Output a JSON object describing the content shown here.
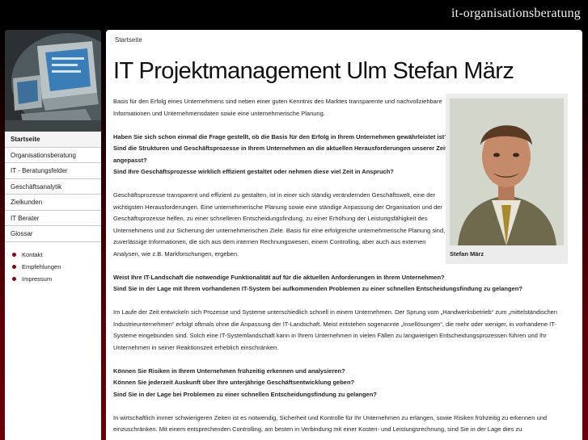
{
  "header": {
    "brand": "it-organisationsberatung"
  },
  "sidebar": {
    "nav": [
      {
        "label": "Startseite",
        "active": true
      },
      {
        "label": "Organisationsberatung",
        "active": false
      },
      {
        "label": "IT - Beratungsfelder",
        "active": false
      },
      {
        "label": "Geschäftsanalytik",
        "active": false
      },
      {
        "label": "Zielkunden",
        "active": false
      },
      {
        "label": "IT Berater",
        "active": false
      },
      {
        "label": "Glossar",
        "active": false
      }
    ],
    "subnav": [
      {
        "label": "Kontakt"
      },
      {
        "label": "Empfehlungen"
      },
      {
        "label": "Impressum"
      }
    ]
  },
  "main": {
    "breadcrumb": "Startseite",
    "title": "IT Projektmanagement Ulm Stefan März",
    "photo_caption": "Stefan März",
    "paragraphs": {
      "p1": "Basis für den Erfolg eines Unternehmens sind neben einer guten Kenntnis des Marktes transparente und nachvollziehbare Informationen und Unternehmensdaten sowie eine unternehmerische Planung.",
      "q1a": "Haben Sie sich schon einmal die Frage gestellt, ob die Basis für den Erfolg in Ihrem Unternehmen gewährleistet ist?",
      "q1b": "Sind die Strukturen und Geschäftsprozesse in Ihrem Unternehmen an die aktuellen Herausforderungen unserer Zeit angepasst?",
      "q1c": "Sind Ihre Geschäftsprozesse wirklich effizient gestaltet oder nehmen diese viel Zeit in Anspruch?",
      "p2": "Geschäftsprozesse transparent und effizient zu gestalten, ist in einer sich ständig verändernden Geschäftswelt, eine der wichtigsten Herausforderungen. Eine unternehmerische Planung sowie eine ständige Anpassung der Organisation und der Geschäftsprozesse helfen, zu einer schnelleren Entscheidungsfindung, zu einer Erhöhung der Leistungsfähigkeit des Unternehmens und zur Sicherung der unternehmerischen Ziele. Basis für eine erfolgreiche unternehmerische Planung sind, zuverlässige Informationen, die sich aus dem internen Rechnungswesen, einem Controlling, aber auch aus externen Analysen, wie z.B. Markforschungen, ergeben.",
      "q2a": "Weist Ihre IT-Landschaft die notwendige Funktionalität auf für die aktuellen Anforderungen in Ihrem Unternehmen?",
      "q2b": "Sind Sie in der Lage mit Ihrem vorhandenen IT-System bei aufkommenden Problemen zu einer schnellen Entscheidungsfindung zu gelangen?",
      "p3": "Im Laufe der Zeit entwickeln sich Prozesse und Systeme unterschiedlich schnell in einem Unternehmen. Der Sprung vom „Handwerksbetrieb“ zum „mittelständischen Industrieunternehmen“ erfolgt oftmals ohne die Anpassung der IT-Landschaft. Meist entstehen sogenannte „Insellösungen“, die mehr oder weniger, in vorhandene IT-Systeme eingebunden sind. Solch eine IT-Systemlandschaft kann in Ihrem Unternehmen in vielen Fällen zu langwierigen Entscheidungsprozessen führen und Ihr Unternehmen in seiner Reaktionszeit erheblich einschränken.",
      "q3a": "Können Sie Risiken in Ihrem Unternehmen frühzeitig erkennen und analysieren?",
      "q3b": "Können Sie jederzeit Auskunft über Ihre unterjährige Geschäftsentwicklung geben?",
      "q3c": "Sind Sie in der Lage bei Problemen zu einer schnellen Entscheidungsfindung zu gelangen?",
      "p4": "In wirtschaftlich immer schwierigeren Zeiten ist es notwendig, Sicherheit und Kontrolle für Ihr Unternehmen zu erlangen, sowie Risiken frühzeitig zu erkennen und einzuschränken. Mit einem entsprechenden Controlling, am besten in Verbindung mit einer Kosten- und Leistungsrechnung, sind Sie in der Lage dies zu"
    }
  }
}
